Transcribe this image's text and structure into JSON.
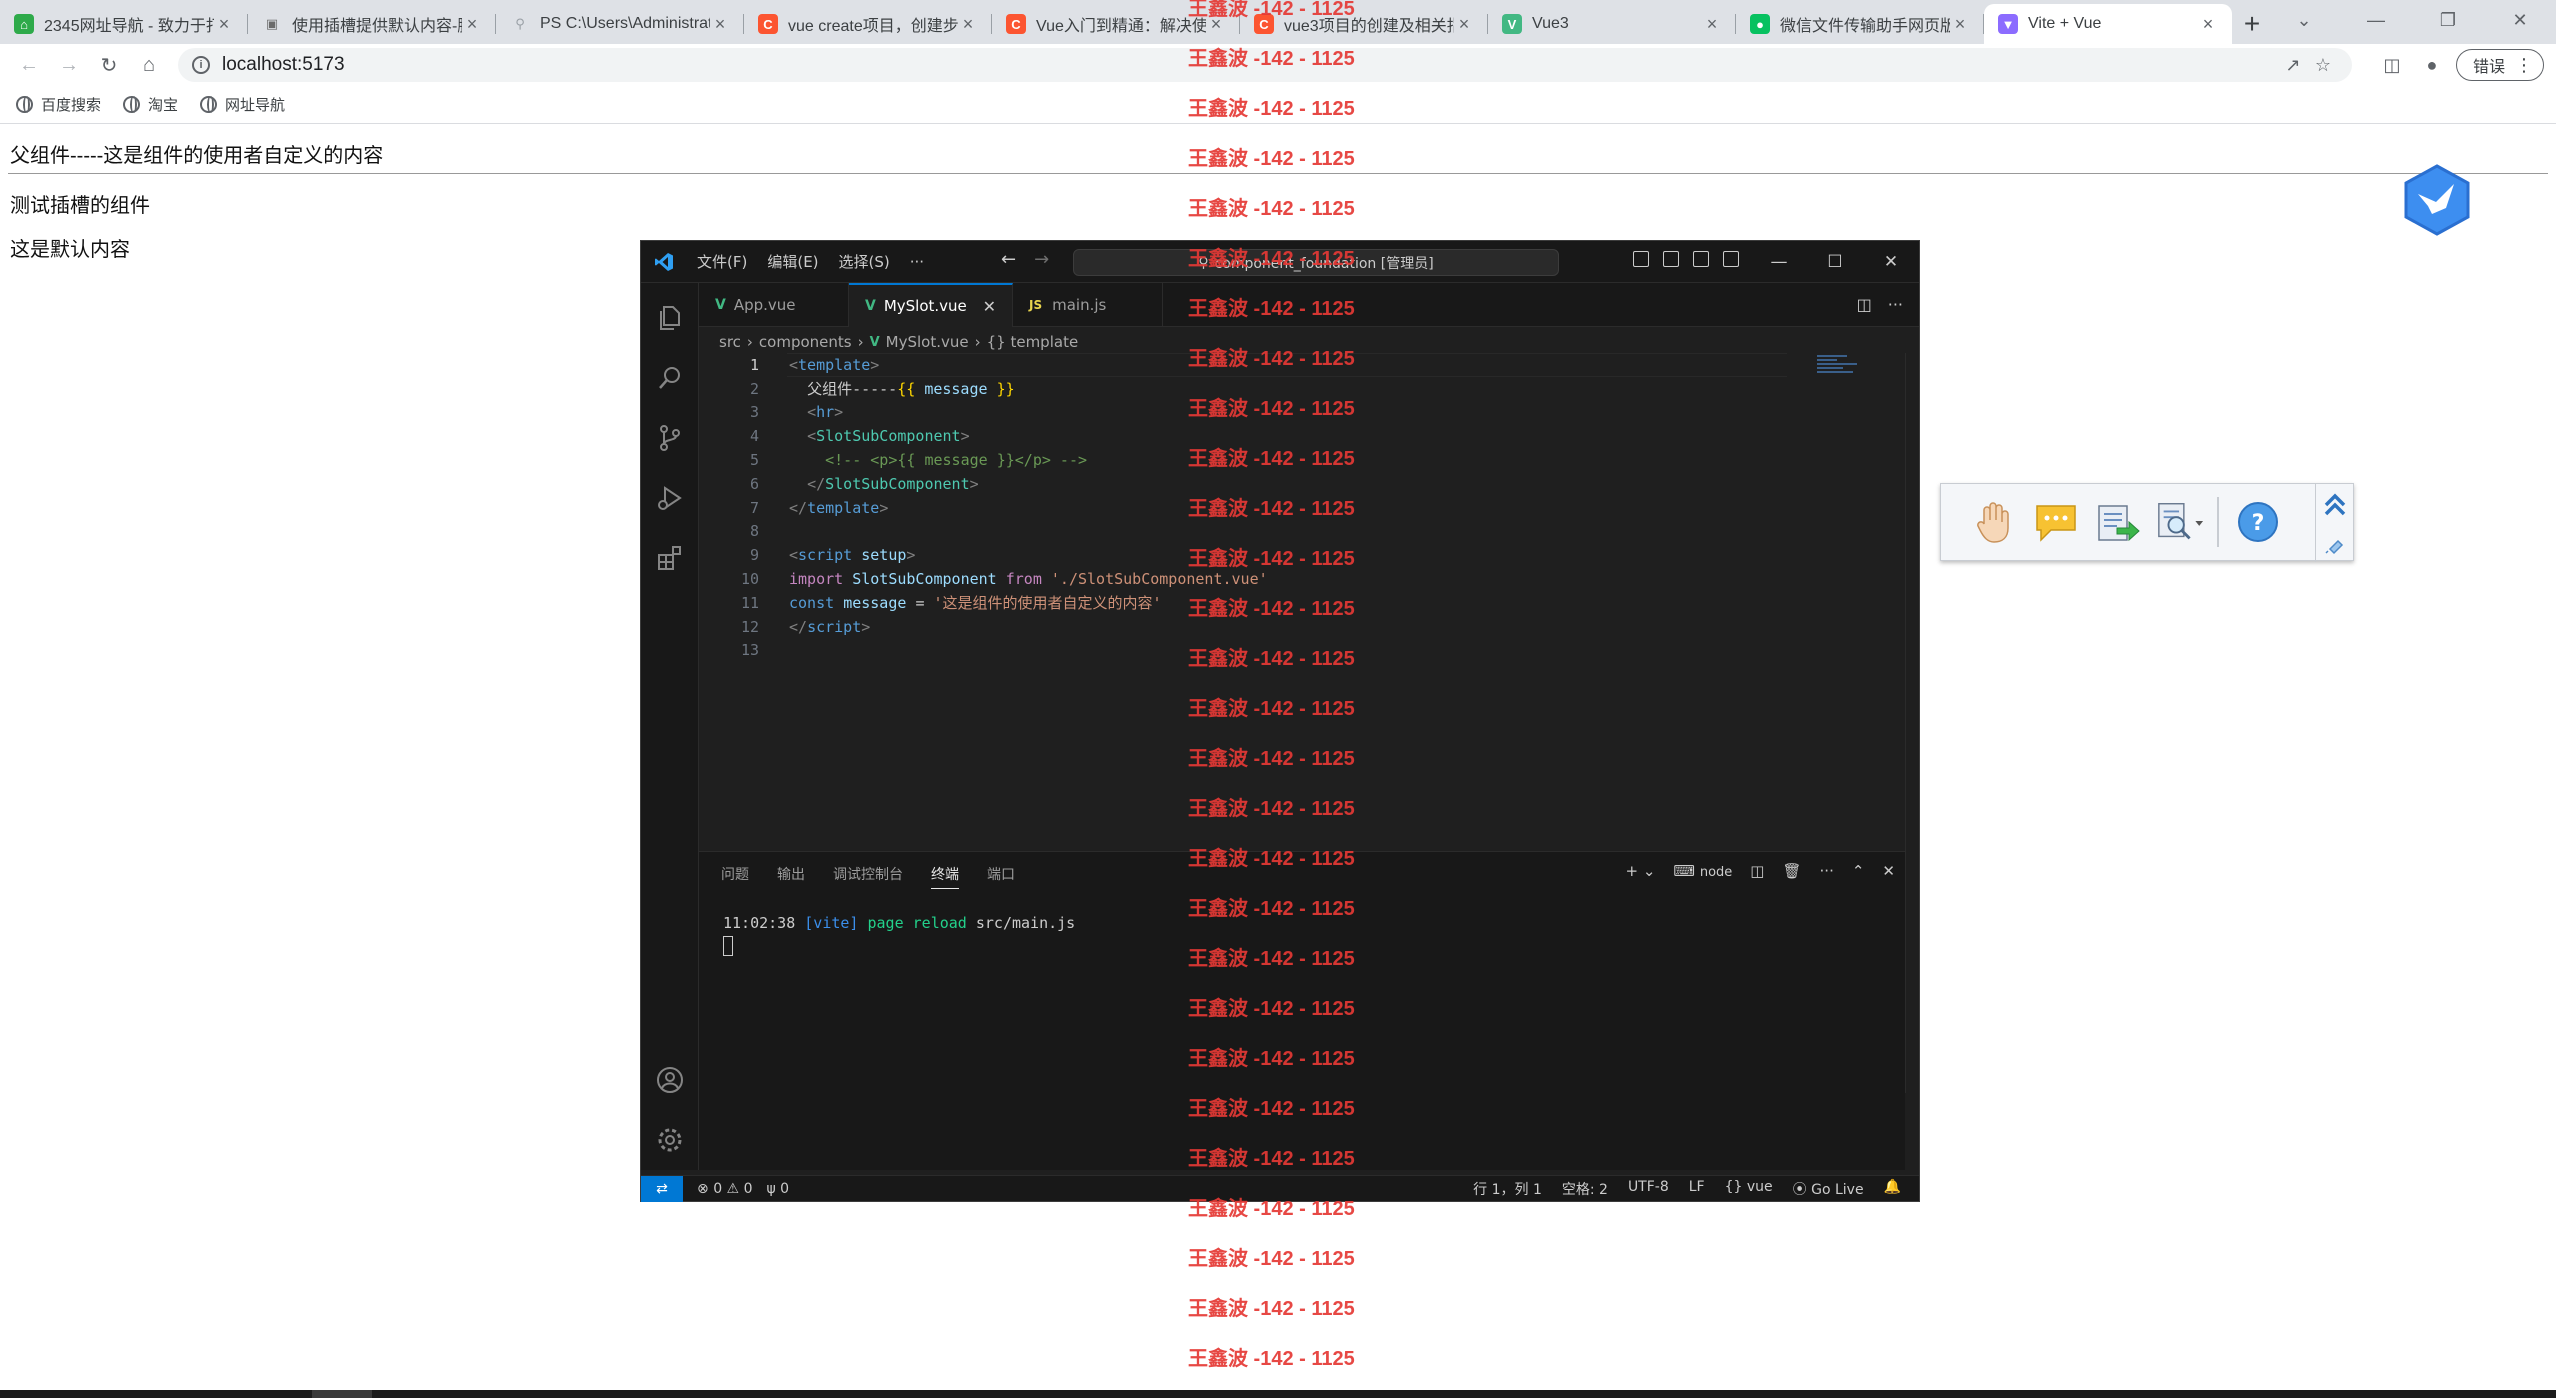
{
  "browser": {
    "tabs": [
      {
        "title": "2345网址导航 - 致力于打",
        "icon": "house-icon",
        "color": "#2eaa4a"
      },
      {
        "title": "使用插槽提供默认内容-脚",
        "icon": "image-icon",
        "color": "#6b6b6b"
      },
      {
        "title": "PS C:\\Users\\Administrat",
        "icon": "search-icon",
        "color": "#9aa0a6"
      },
      {
        "title": "vue create项目，创建步",
        "icon": "csdn-icon",
        "color": "#fc5531"
      },
      {
        "title": "Vue入门到精通：解决使",
        "icon": "csdn-icon",
        "color": "#fc5531"
      },
      {
        "title": "vue3项目的创建及相关指",
        "icon": "csdn-icon",
        "color": "#fc5531"
      },
      {
        "title": "Vue3",
        "icon": "vue-icon",
        "color": "#42b883"
      },
      {
        "title": "微信文件传输助手网页版",
        "icon": "wechat-icon",
        "color": "#07c160"
      },
      {
        "title": "Vite + Vue",
        "icon": "vite-icon",
        "color": "#8c6cff",
        "active": true
      }
    ],
    "new_tab": "+",
    "window_controls": [
      "⌄",
      "—",
      "❐",
      "✕"
    ],
    "url": "localhost:5173",
    "error_button": "错误",
    "bookmarks": [
      "百度搜索",
      "淘宝",
      "网址导航"
    ]
  },
  "page": {
    "line1": "父组件-----这是组件的使用者自定义的内容",
    "line2": "测试插槽的组件",
    "line3": "这是默认内容"
  },
  "vscode": {
    "menus": [
      "文件(F)",
      "编辑(E)",
      "选择(S)",
      "···"
    ],
    "command_center": "component_foundation [管理员]",
    "tabs": [
      {
        "label": "App.vue",
        "kind": "vue"
      },
      {
        "label": "MySlot.vue",
        "kind": "vue",
        "active": true
      },
      {
        "label": "main.js",
        "kind": "js"
      }
    ],
    "breadcrumb": [
      "src",
      "components",
      "MySlot.vue",
      "{} template"
    ],
    "line_numbers": [
      "1",
      "2",
      "3",
      "4",
      "5",
      "6",
      "7",
      "8",
      "9",
      "10",
      "11",
      "12",
      "13"
    ],
    "panel_tabs": [
      "问题",
      "输出",
      "调试控制台",
      "终端",
      "端口"
    ],
    "panel_active": "终端",
    "terminal": {
      "time": "11:02:38",
      "tag": "[vite]",
      "msg": "page reload",
      "file": "src/main.js"
    },
    "terminal_name": "node",
    "status": {
      "errors": "0",
      "warnings": "0",
      "ports": "0",
      "position": "行 1，列 1",
      "spaces": "空格: 2",
      "encoding": "UTF-8",
      "eol": "LF",
      "language": "vue",
      "golive": "Go Live"
    }
  },
  "watermark": "王鑫波 -142 - 1125"
}
